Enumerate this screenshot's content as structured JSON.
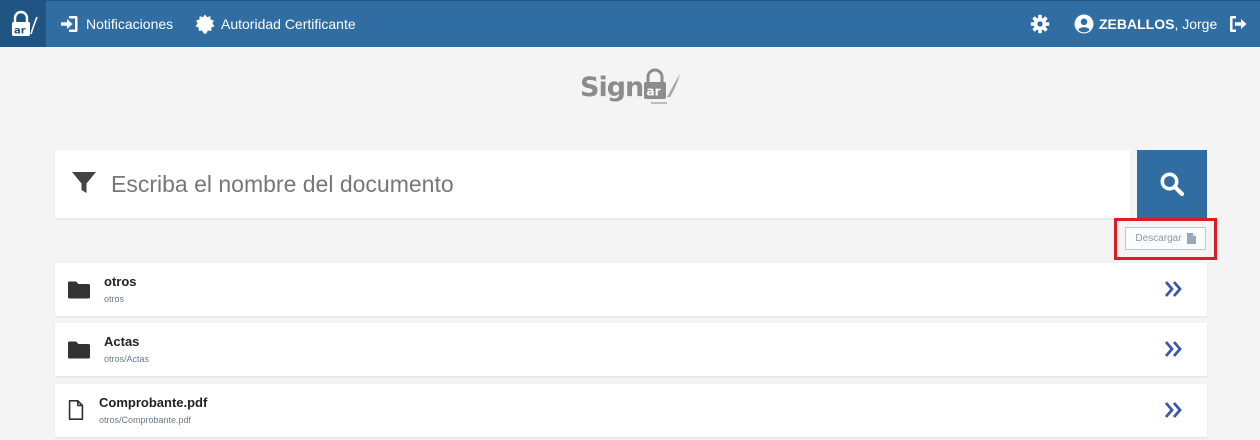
{
  "nav": {
    "notifications_label": "Notificaciones",
    "ca_label": "Autoridad Certificante",
    "user_last": "ZEBALLOS",
    "user_first": ", Jorge"
  },
  "logo": {
    "text": "Sign",
    "badge": "ar"
  },
  "search": {
    "placeholder": "Escriba el nombre del documento",
    "value": ""
  },
  "download_label": "Descargar",
  "items": [
    {
      "type": "folder",
      "title": "otros",
      "path": "otros"
    },
    {
      "type": "folder",
      "title": "Actas",
      "path": "otros/Actas"
    },
    {
      "type": "file",
      "title": "Comprobante.pdf",
      "path": "otros/Comprobante.pdf"
    }
  ],
  "colors": {
    "topbar": "#2f6da3",
    "brand": "#1f5484",
    "highlight": "#e01b24",
    "chevron": "#3a57a8"
  }
}
